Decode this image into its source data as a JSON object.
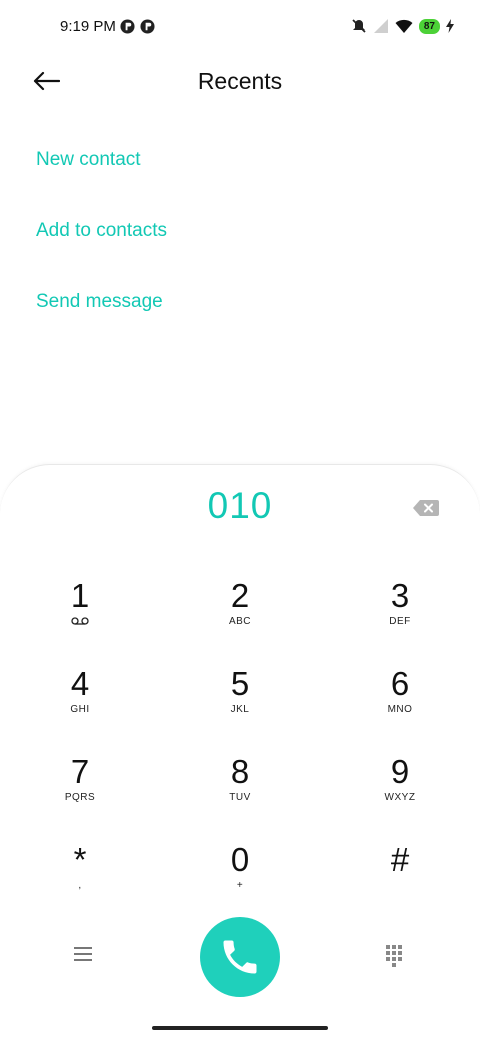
{
  "status_bar": {
    "time": "9:19 PM",
    "battery": "87",
    "icons": [
      "notification-icon",
      "notification-icon",
      "silent-icon",
      "signal-icon",
      "wifi-icon",
      "battery-icon",
      "charging-icon"
    ]
  },
  "header": {
    "title": "Recents",
    "back_icon": "arrow-left-icon"
  },
  "menu": {
    "items": [
      {
        "label": "New contact"
      },
      {
        "label": "Add to contacts"
      },
      {
        "label": "Send message"
      }
    ]
  },
  "dialer": {
    "number": "010",
    "keys": [
      {
        "digit": "1",
        "letters": ""
      },
      {
        "digit": "2",
        "letters": "ABC"
      },
      {
        "digit": "3",
        "letters": "DEF"
      },
      {
        "digit": "4",
        "letters": "GHI"
      },
      {
        "digit": "5",
        "letters": "JKL"
      },
      {
        "digit": "6",
        "letters": "MNO"
      },
      {
        "digit": "7",
        "letters": "PQRS"
      },
      {
        "digit": "8",
        "letters": "TUV"
      },
      {
        "digit": "9",
        "letters": "WXYZ"
      },
      {
        "digit": "*",
        "letters": ","
      },
      {
        "digit": "0",
        "letters": "+"
      },
      {
        "digit": "#",
        "letters": ""
      }
    ]
  },
  "colors": {
    "accent": "#12c8b4",
    "call_button": "#1fd0bb"
  }
}
